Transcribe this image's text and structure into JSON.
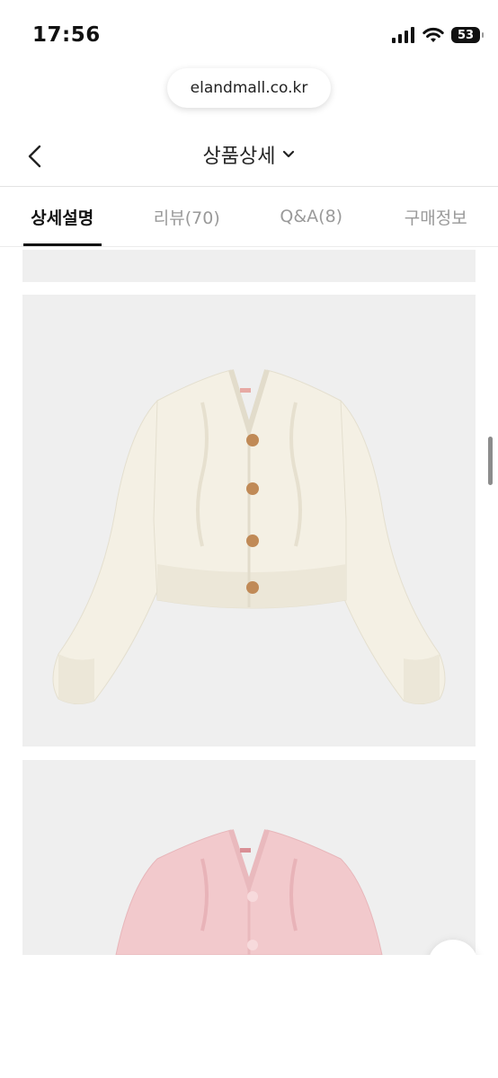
{
  "status_bar": {
    "time": "17:56",
    "battery": "53",
    "icons": [
      "cellular-signal-icon",
      "wifi-icon",
      "battery-icon"
    ]
  },
  "browser": {
    "url": "elandmall.co.kr"
  },
  "header": {
    "title": "상품상세",
    "back_icon": "chevron-left-icon",
    "title_icon": "chevron-down-icon"
  },
  "tabs": [
    {
      "label": "상세설명",
      "active": true
    },
    {
      "label": "리뷰(70)",
      "active": false
    },
    {
      "label": "Q&A(8)",
      "active": false
    },
    {
      "label": "구매정보",
      "active": false
    }
  ],
  "colors": {
    "cream_cardigan": "#f4f0e4",
    "pink_cardigan": "#f2c9cc",
    "button_brown": "#c08a57",
    "image_background": "#efefef"
  }
}
